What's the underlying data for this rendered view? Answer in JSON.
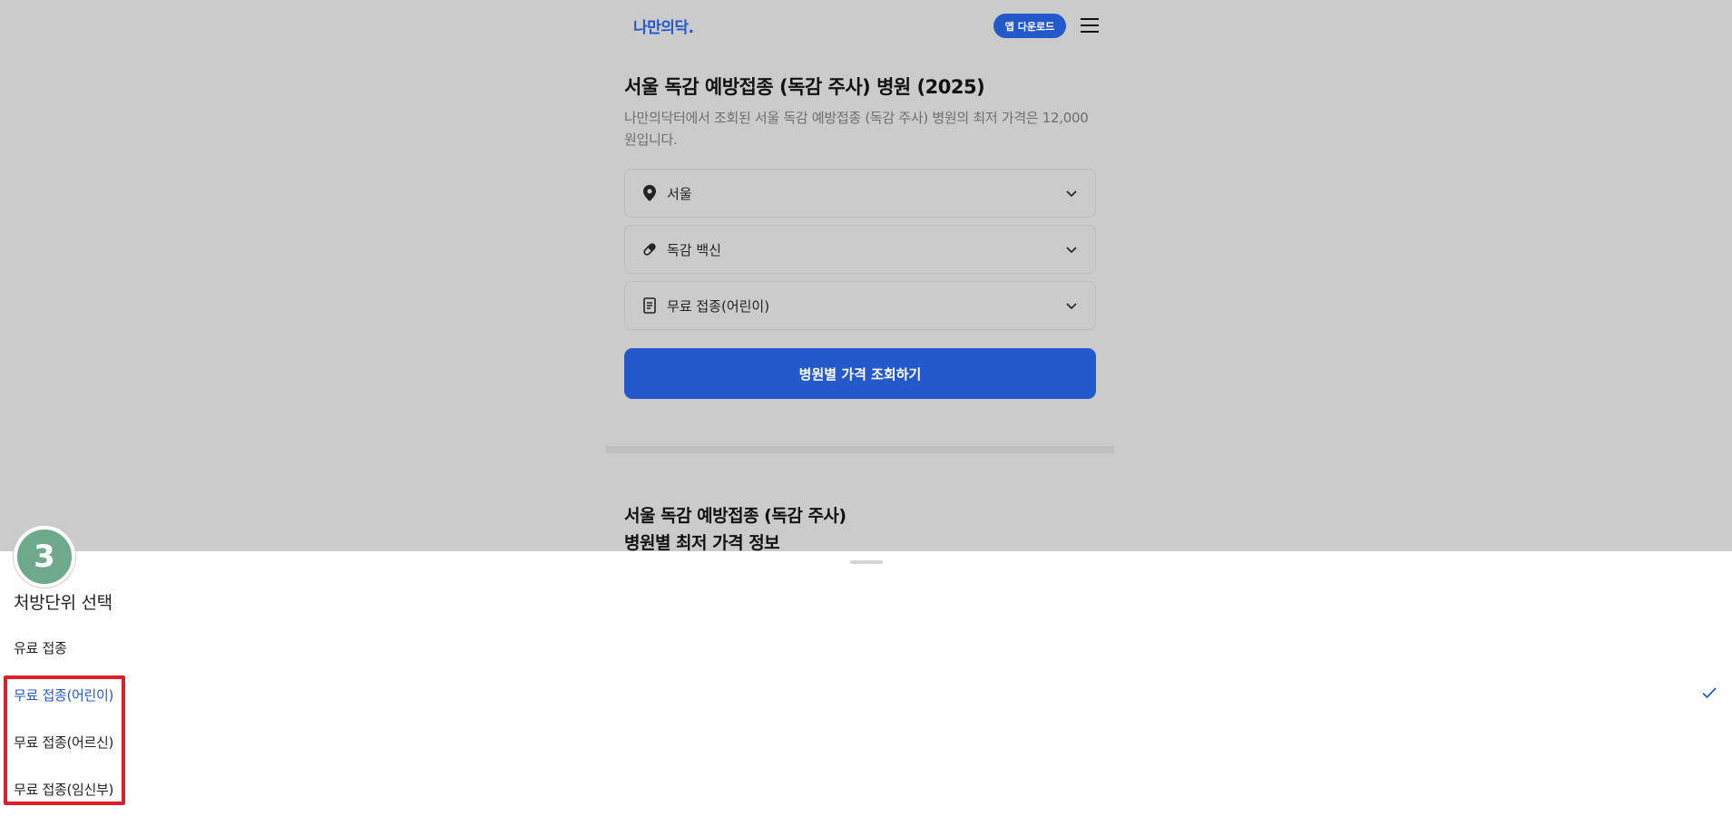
{
  "header": {
    "logo_text": "나만의닥.",
    "app_download_label": "앱 다운로드",
    "menu_icon": "hamburger-menu-icon"
  },
  "main": {
    "title": "서울 독감 예방접종 (독감 주사) 병원 (2025)",
    "description": "나만의닥터에서 조회된 서울 독감 예방접종 (독감 주사) 병원의 최저 가격은 12,000원입니다.",
    "filters": {
      "region": {
        "icon": "location-pin-icon",
        "value": "서울"
      },
      "vaccine": {
        "icon": "pill-icon",
        "value": "독감 백신"
      },
      "unit": {
        "icon": "document-icon",
        "value": "무료 접종(어린이)"
      }
    },
    "search_button_label": "병원별 가격 조회하기",
    "section_title_line1": "서울 독감 예방접종 (독감 주사)",
    "section_title_line2": "병원별 최저 가격 정보"
  },
  "sheet": {
    "title": "처방단위 선택",
    "options": [
      {
        "label": "유료 접종",
        "selected": false
      },
      {
        "label": "무료 접종(어린이)",
        "selected": true
      },
      {
        "label": "무료 접종(어르신)",
        "selected": false
      },
      {
        "label": "무료 접종(임신부)",
        "selected": false
      }
    ],
    "check_icon": "checkmark-icon"
  },
  "annotation": {
    "step_number": "3",
    "highlight_color": "#e01e2a",
    "badge_color": "#6fa98c"
  },
  "colors": {
    "brand": "#2459cc",
    "overlay_bg": "#cbcbcb"
  }
}
